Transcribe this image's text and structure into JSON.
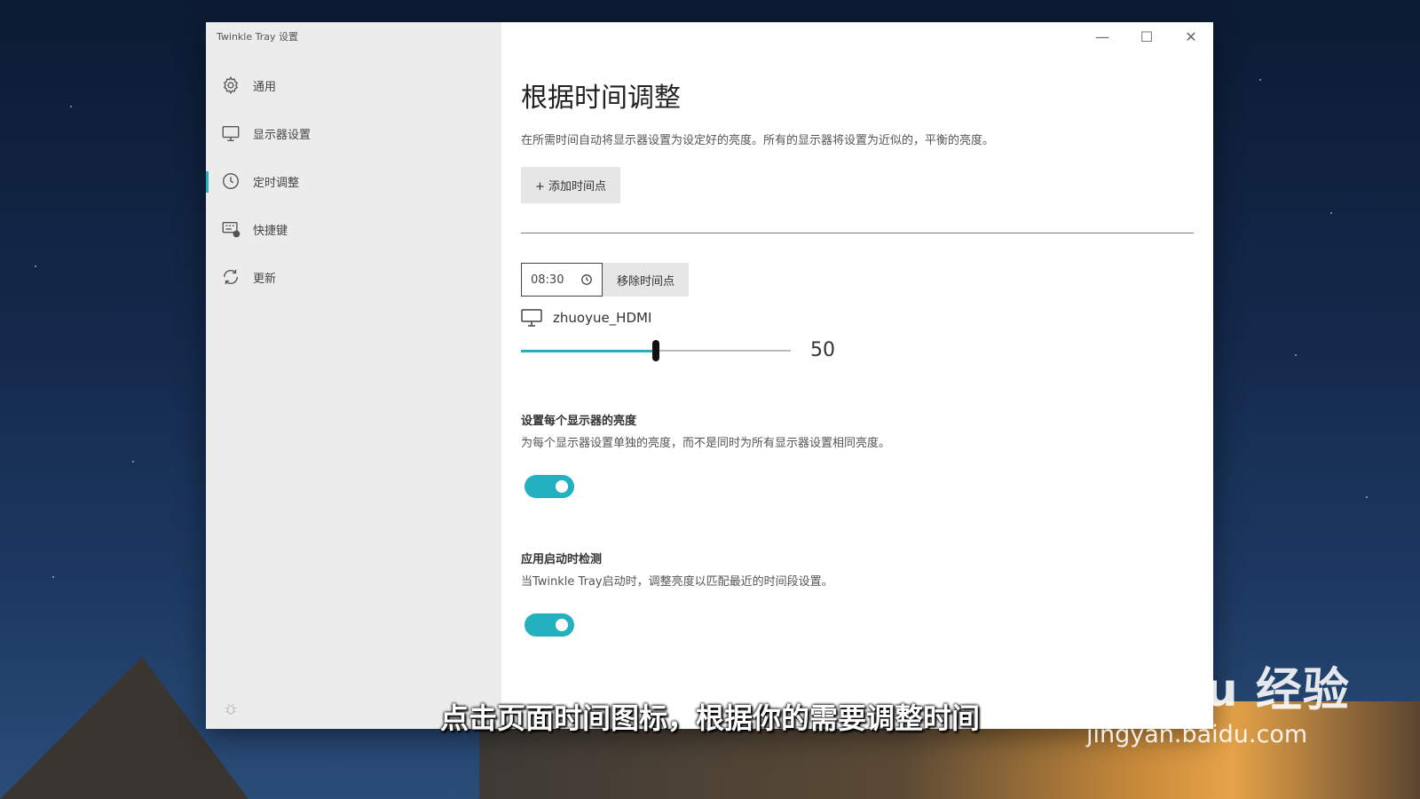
{
  "window": {
    "title": "Twinkle Tray 设置",
    "controls": {
      "minimize": "—",
      "maximize": "☐",
      "close": "✕"
    }
  },
  "sidebar": {
    "items": [
      {
        "label": "通用",
        "icon": "gear-icon"
      },
      {
        "label": "显示器设置",
        "icon": "monitor-icon"
      },
      {
        "label": "定时调整",
        "icon": "clock-icon",
        "active": true
      },
      {
        "label": "快捷键",
        "icon": "keyboard-icon"
      },
      {
        "label": "更新",
        "icon": "refresh-icon"
      }
    ]
  },
  "main": {
    "title": "根据时间调整",
    "description": "在所需时间自动将显示器设置为设定好的亮度。所有的显示器将设置为近似的，平衡的亮度。",
    "add_button": "+ 添加时间点",
    "time_entry": {
      "time": "08:30",
      "remove_button": "移除时间点",
      "monitor_name": "zhuoyue_HDMI",
      "brightness": 50,
      "brightness_label": "50"
    },
    "settings": [
      {
        "title": "设置每个显示器的亮度",
        "description": "为每个显示器设置单独的亮度，而不是同时为所有显示器设置相同亮度。",
        "enabled": true
      },
      {
        "title": "应用启动时检测",
        "description": "当Twinkle Tray启动时，调整亮度以匹配最近的时间段设置。",
        "enabled": true
      }
    ]
  },
  "overlay": {
    "subtitle": "点击页面时间图标，根据你的需要调整时间",
    "watermark_logo": "Baidu 经验",
    "watermark_url": "jingyan.baidu.com"
  },
  "colors": {
    "accent": "#23b1bf",
    "sidebar_bg": "#ececec"
  }
}
